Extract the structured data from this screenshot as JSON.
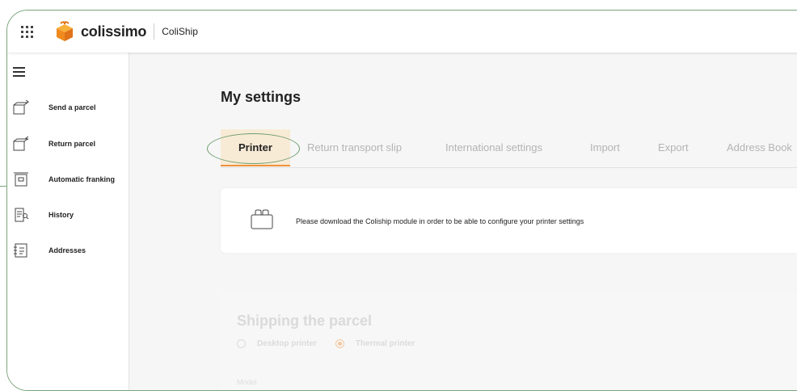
{
  "header": {
    "logo_text": "colissimo",
    "app_name": "ColiShip"
  },
  "sidebar": {
    "items": [
      {
        "label": "Send a parcel",
        "icon": "send-parcel-icon"
      },
      {
        "label": "Return parcel",
        "icon": "return-parcel-icon"
      },
      {
        "label": "Automatic franking",
        "icon": "franking-icon"
      },
      {
        "label": "History",
        "icon": "history-icon"
      },
      {
        "label": "Addresses",
        "icon": "addresses-icon"
      }
    ]
  },
  "main": {
    "title": "My settings",
    "tabs": [
      {
        "label": "Printer",
        "active": true
      },
      {
        "label": "Return transport slip"
      },
      {
        "label": "International settings"
      },
      {
        "label": "Import"
      },
      {
        "label": "Export"
      },
      {
        "label": "Address Book"
      }
    ],
    "notice": {
      "message": "Please download the Coliship module in order to be able to configure your printer settings"
    },
    "shipping": {
      "title": "Shipping the parcel",
      "options": [
        {
          "label": "Desktop printer",
          "checked": false
        },
        {
          "label": "Thermal printer",
          "checked": true
        }
      ],
      "model_label": "Model"
    }
  },
  "colors": {
    "accent": "#f0913a",
    "active_tab_bg": "#f8ebd6",
    "highlight": "#6e9e6e"
  }
}
